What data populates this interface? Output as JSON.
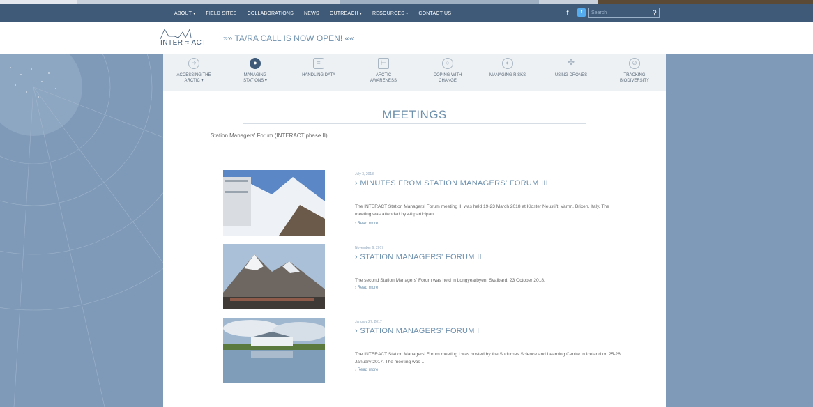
{
  "nav": {
    "items": [
      {
        "label": "ABOUT",
        "dropdown": true
      },
      {
        "label": "FIELD SITES",
        "dropdown": false
      },
      {
        "label": "COLLABORATIONS",
        "dropdown": false
      },
      {
        "label": "NEWS",
        "dropdown": false
      },
      {
        "label": "OUTREACH",
        "dropdown": true
      },
      {
        "label": "RESOURCES",
        "dropdown": true
      },
      {
        "label": "CONTACT US",
        "dropdown": false
      }
    ],
    "social": {
      "facebook": "f",
      "twitter": "t",
      "rss": "r"
    },
    "search_placeholder": "Search"
  },
  "header": {
    "logo_text": "INTER ≈ ACT",
    "announcement": "»» TA/RA CALL IS NOW OPEN! ««"
  },
  "categories": [
    {
      "label1": "ACCESSING THE",
      "label2": "ARCTIC ▾",
      "icon": "arrow-circle-icon"
    },
    {
      "label1": "MANAGING",
      "label2": "STATIONS ▾",
      "icon": "speech-bubble-icon",
      "active": true
    },
    {
      "label1": "HANDLING DATA",
      "label2": "",
      "icon": "database-icon"
    },
    {
      "label1": "ARCTIC",
      "label2": "AWARENESS",
      "icon": "signpost-icon"
    },
    {
      "label1": "COPING WITH",
      "label2": "CHANGE",
      "icon": "thermometer-icon"
    },
    {
      "label1": "MANAGING RISKS",
      "label2": "",
      "icon": "shield-icon"
    },
    {
      "label1": "USING DRONES",
      "label2": "",
      "icon": "drone-icon"
    },
    {
      "label1": "TRACKING",
      "label2": "BIODIVERSITY",
      "icon": "compass-icon"
    }
  ],
  "page": {
    "title": "MEETINGS",
    "intro": "Station Managers' Forum (INTERACT phase II)"
  },
  "posts": [
    {
      "date": "July 3, 2018",
      "title": "› MINUTES FROM STATION MANAGERS' FORUM III",
      "excerpt": "The INTERACT Station Managers' Forum meeting III was held 19-23 March 2018 at Kloster Neustift, Varhn, Brixen, Italy. The meeting was attended by 40 participant ..",
      "more": "› Read more"
    },
    {
      "date": "November 6, 2017",
      "title": "› STATION MANAGERS' FORUM II",
      "excerpt": "The second Station Managers' Forum was held in Longyearbyen, Svalbard, 23 October 2018.",
      "more": "› Read more"
    },
    {
      "date": "January 27, 2017",
      "title": "› STATION MANAGERS' FORUM I",
      "excerpt": "The INTERACT Station Managers' Forum meeting I was hosted by the Sudurnes Science and Learning Centre in Iceland on 25-26 January 2017. The meeting was ..",
      "more": "› Read more"
    }
  ],
  "colors": {
    "nav_bg": "#3e5a78",
    "accent": "#6d90ad",
    "side_bg": "#7f9ab8"
  }
}
